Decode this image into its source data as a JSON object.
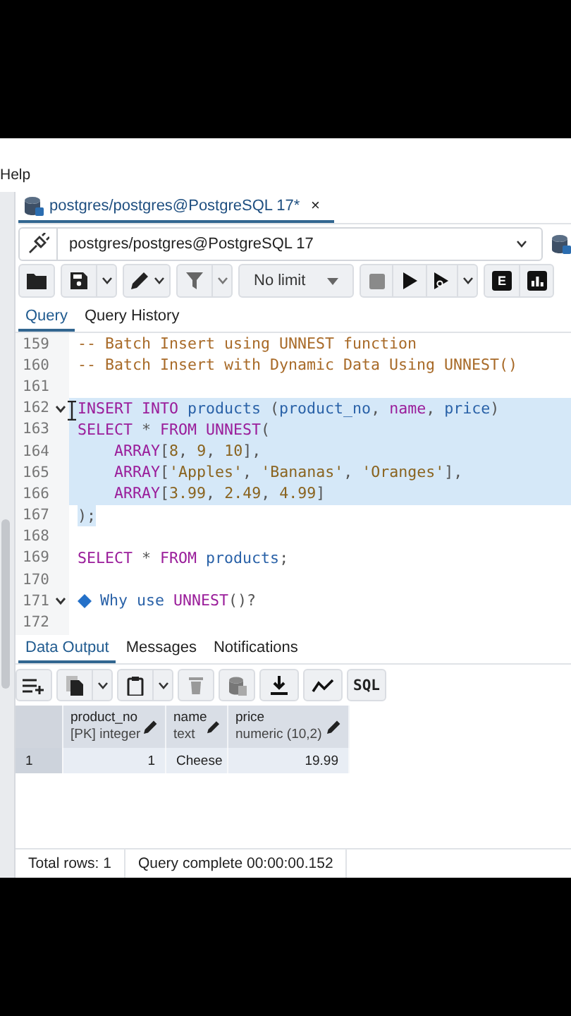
{
  "menu": {
    "items": [
      {
        "label": "Help"
      }
    ]
  },
  "editor_tab": {
    "title": "postgres/postgres@PostgreSQL 17*",
    "close": "×"
  },
  "connection": {
    "value": "postgres/postgres@PostgreSQL 17"
  },
  "toolbar": {
    "limit": "No limit",
    "explain_key": "E"
  },
  "query_tabs": [
    {
      "label": "Query",
      "selected": true
    },
    {
      "label": "Query History",
      "selected": false
    }
  ],
  "editor": {
    "lines": [
      {
        "number": "159",
        "kind": "code",
        "selected": false,
        "fold_marker": false,
        "tokens": [
          {
            "text": "-- Batch Insert using UNNEST function",
            "kind": "comment"
          }
        ]
      },
      {
        "number": "160",
        "kind": "code",
        "selected": false,
        "fold_marker": false,
        "tokens": [
          {
            "text": "-- Batch Insert with Dynamic Data Using UNNEST()",
            "kind": "comment"
          }
        ]
      },
      {
        "number": "161",
        "kind": "code",
        "selected": false,
        "fold_marker": false
      },
      {
        "number": "162",
        "kind": "code",
        "selected": true,
        "fold_marker": true,
        "tokens": [
          {
            "text": "INSERT INTO",
            "kind": "keyword"
          },
          {
            "text": " products",
            "kind": "identifier"
          },
          {
            "text": " (",
            "kind": "punct"
          },
          {
            "text": "product_no",
            "kind": "identifier"
          },
          {
            "text": ", ",
            "kind": "punct"
          },
          {
            "text": "name",
            "kind": "keyword"
          },
          {
            "text": ", ",
            "kind": "punct"
          },
          {
            "text": "price",
            "kind": "identifier"
          },
          {
            "text": ")",
            "kind": "punct"
          }
        ]
      },
      {
        "number": "163",
        "kind": "code",
        "selected": true,
        "fold_marker": false,
        "tokens": [
          {
            "text": "SELECT",
            "kind": "keyword"
          },
          {
            "text": " * ",
            "kind": "punct"
          },
          {
            "text": "FROM UNNEST",
            "kind": "keyword"
          },
          {
            "text": "(",
            "kind": "punct"
          }
        ]
      },
      {
        "number": "164",
        "kind": "code",
        "selected": true,
        "fold_marker": false,
        "tokens": [
          {
            "text": "    ARRAY",
            "kind": "keyword"
          },
          {
            "text": "[",
            "kind": "punct"
          },
          {
            "text": "8",
            "kind": "number"
          },
          {
            "text": ", ",
            "kind": "punct"
          },
          {
            "text": "9",
            "kind": "number"
          },
          {
            "text": ", ",
            "kind": "punct"
          },
          {
            "text": "10",
            "kind": "number"
          },
          {
            "text": "],",
            "kind": "punct"
          }
        ]
      },
      {
        "number": "165",
        "kind": "code",
        "selected": true,
        "fold_marker": false,
        "tokens": [
          {
            "text": "    ARRAY",
            "kind": "keyword"
          },
          {
            "text": "[",
            "kind": "punct"
          },
          {
            "text": "'Apples'",
            "kind": "string"
          },
          {
            "text": ", ",
            "kind": "punct"
          },
          {
            "text": "'Bananas'",
            "kind": "string"
          },
          {
            "text": ", ",
            "kind": "punct"
          },
          {
            "text": "'Oranges'",
            "kind": "string"
          },
          {
            "text": "],",
            "kind": "punct"
          }
        ]
      },
      {
        "number": "166",
        "kind": "code",
        "selected": true,
        "fold_marker": false,
        "tokens": [
          {
            "text": "    ARRAY",
            "kind": "keyword"
          },
          {
            "text": "[",
            "kind": "punct"
          },
          {
            "text": "3.99",
            "kind": "number"
          },
          {
            "text": ", ",
            "kind": "punct"
          },
          {
            "text": "2.49",
            "kind": "number"
          },
          {
            "text": ", ",
            "kind": "punct"
          },
          {
            "text": "4.99",
            "kind": "number"
          },
          {
            "text": "]",
            "kind": "punct"
          }
        ]
      },
      {
        "number": "167",
        "kind": "code",
        "selected": true,
        "fold_marker": false,
        "tokens": [
          {
            "text": ");",
            "kind": "punct"
          }
        ]
      },
      {
        "number": "168",
        "kind": "code",
        "selected": false,
        "fold_marker": false
      },
      {
        "number": "169",
        "kind": "code",
        "selected": false,
        "fold_marker": false,
        "tokens": [
          {
            "text": "SELECT",
            "kind": "keyword"
          },
          {
            "text": " * ",
            "kind": "punct"
          },
          {
            "text": "FROM",
            "kind": "keyword"
          },
          {
            "text": " products",
            "kind": "identifier"
          },
          {
            "text": ";",
            "kind": "punct"
          }
        ]
      },
      {
        "number": "170",
        "kind": "code",
        "selected": false,
        "fold_marker": false
      },
      {
        "number": "171",
        "kind": "note",
        "selected": false,
        "fold_marker": true,
        "tokens": [
          {
            "text": "Why use ",
            "kind": "identifier"
          },
          {
            "text": "UNNEST",
            "kind": "keyword"
          },
          {
            "text": "()?",
            "kind": "punct"
          }
        ]
      },
      {
        "number": "172",
        "kind": "code",
        "selected": false,
        "fold_marker": false
      }
    ]
  },
  "output_tabs": [
    {
      "label": "Data Output",
      "selected": true
    },
    {
      "label": "Messages",
      "selected": false
    },
    {
      "label": "Notifications",
      "selected": false
    }
  ],
  "output_toolbar": {
    "sql_button": "SQL"
  },
  "grid": {
    "columns": [
      {
        "name": "product_no",
        "type": "[PK] integer",
        "numeric": true
      },
      {
        "name": "name",
        "type": "text",
        "numeric": false
      },
      {
        "name": "price",
        "type": "numeric (10,2)",
        "numeric": true
      }
    ],
    "rows": [
      {
        "number": "1",
        "cells": [
          "1",
          "Cheese",
          "19.99"
        ]
      }
    ]
  },
  "status_bar": {
    "total_rows": "Total rows: 1",
    "query_status": "Query complete 00:00:00.152"
  }
}
